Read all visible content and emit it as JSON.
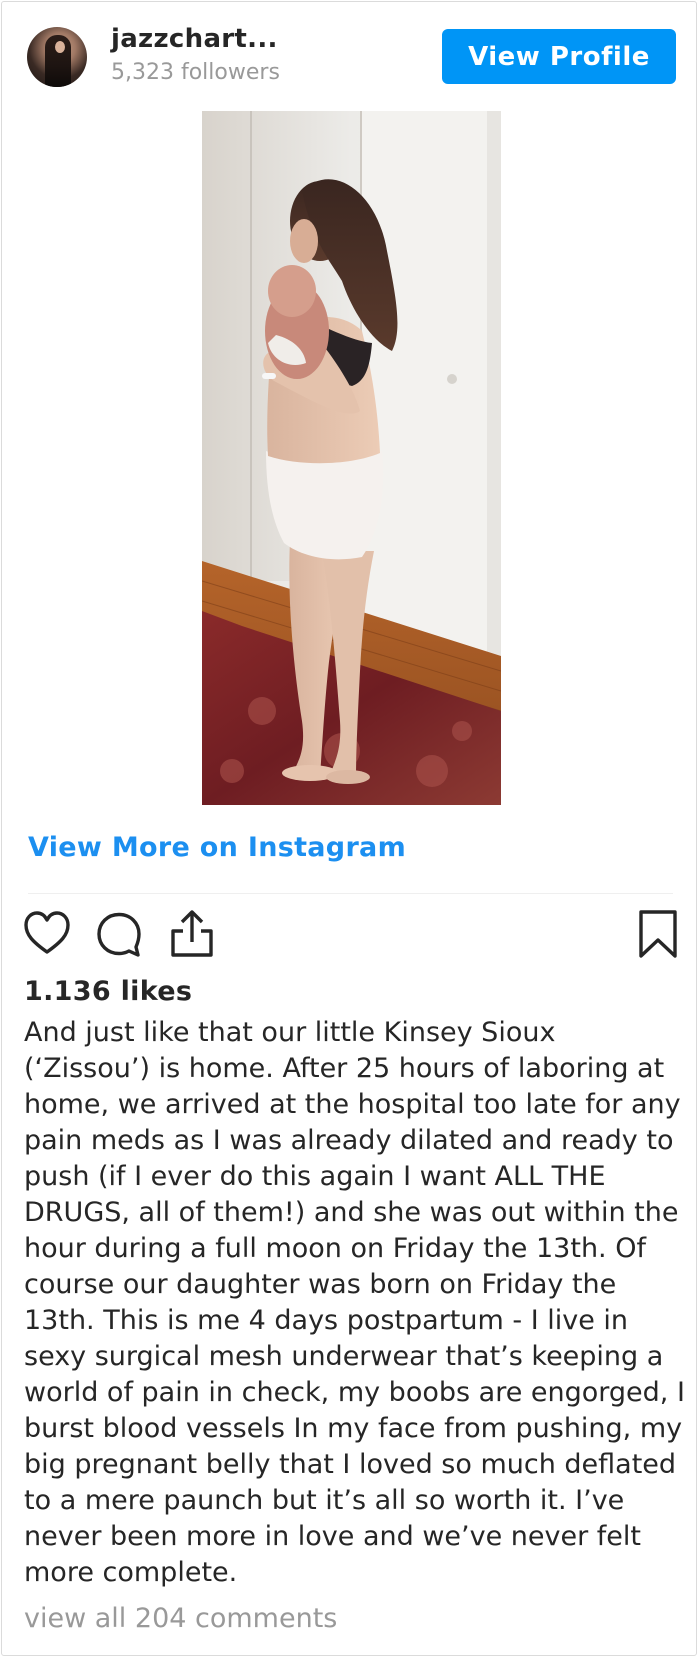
{
  "header": {
    "username": "jazzchart...",
    "followers": "5,323 followers",
    "view_profile_label": "View Profile"
  },
  "post": {
    "view_more_label": "View More on Instagram",
    "likes": "1.136 likes",
    "caption": "And just like that our little Kinsey Sioux (‘Zissou’) is home. After 25 hours of laboring at home, we arrived at the hospital too late for any pain meds as I was already dilated and ready to push (if I ever do this again I want ALL THE DRUGS, all of them!) and she was out within the hour during a full moon on Friday the 13th. Of course our daughter was born on Friday the 13th. This is me 4 days postpartum - I live in sexy surgical mesh underwear that’s keeping a world of pain in check, my boobs are engorged, I burst blood vessels In my face from pushing, my big pregnant belly that I loved so much deflated to a mere paunch but it’s all so worth it. I’ve never been more in love and we’ve never felt more complete.",
    "view_comments_label": "view all 204 comments"
  },
  "icons": {
    "like": "heart-icon",
    "comment": "comment-icon",
    "share": "share-icon",
    "save": "bookmark-icon"
  },
  "colors": {
    "accent": "#0095f6",
    "link": "#1c8ff0",
    "muted": "#999999",
    "text": "#262626"
  }
}
